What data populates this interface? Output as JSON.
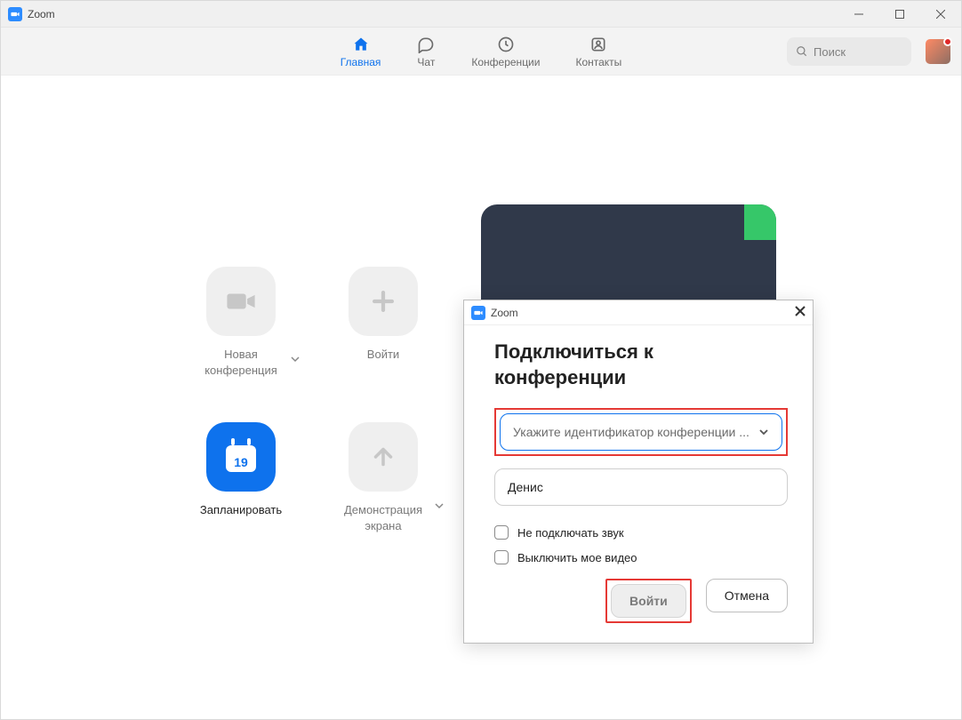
{
  "window": {
    "title": "Zoom"
  },
  "tabs": {
    "home": "Главная",
    "chat": "Чат",
    "meetings": "Конференции",
    "contacts": "Контакты"
  },
  "search": {
    "placeholder": "Поиск"
  },
  "tiles": {
    "new_meeting": "Новая конференция",
    "join": "Войти",
    "schedule": "Запланировать",
    "schedule_date": "19",
    "share_screen": "Демонстрация экрана"
  },
  "dialog": {
    "window_title": "Zoom",
    "heading": "Подключиться к конференции",
    "meeting_id_placeholder": "Укажите идентификатор конференции ...",
    "name_value": "Денис",
    "checkbox_audio": "Не подключать звук",
    "checkbox_video": "Выключить мое видео",
    "join_button": "Войти",
    "cancel_button": "Отмена"
  }
}
